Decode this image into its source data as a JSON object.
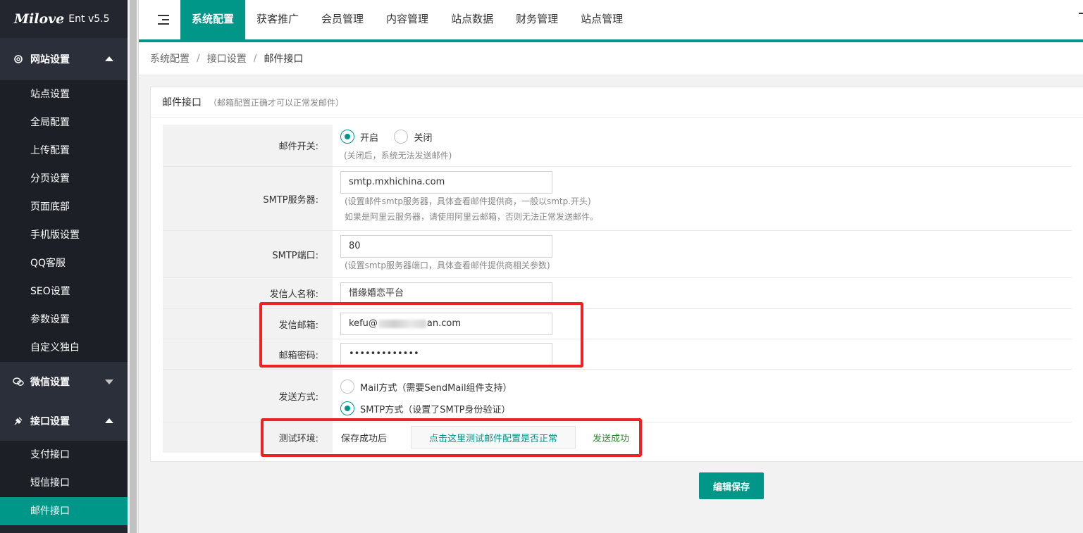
{
  "app": {
    "brand": "Milove",
    "version": "Ent v5.5"
  },
  "sidebar": {
    "groups": [
      {
        "label": "网站设置",
        "icon": "gear-icon",
        "expanded": true,
        "items": [
          "站点设置",
          "全局配置",
          "上传配置",
          "分页设置",
          "页面底部",
          "手机版设置",
          "QQ客服",
          "SEO设置",
          "参数设置",
          "自定义独白"
        ]
      },
      {
        "label": "微信设置",
        "icon": "wechat-icon",
        "expanded": false,
        "items": []
      },
      {
        "label": "接口设置",
        "icon": "plug-icon",
        "expanded": true,
        "items": [
          "支付接口",
          "短信接口",
          "邮件接口"
        ]
      }
    ],
    "active_item": "邮件接口"
  },
  "topnav": {
    "tabs": [
      "系统配置",
      "获客推广",
      "会员管理",
      "内容管理",
      "站点数据",
      "财务管理",
      "站点管理"
    ],
    "active": "系统配置"
  },
  "breadcrumb": {
    "items": [
      "系统配置",
      "接口设置",
      "邮件接口"
    ],
    "separator": "/"
  },
  "card": {
    "title": "邮件接口",
    "desc": "（邮箱配置正确才可以正常发邮件）"
  },
  "form": {
    "mail_switch": {
      "label": "邮件开关:",
      "options": [
        "开启",
        "关闭"
      ],
      "selected": "开启",
      "hint": "(关闭后，系统无法发送邮件)"
    },
    "smtp_server": {
      "label": "SMTP服务器:",
      "value": "smtp.mxhichina.com",
      "hint1": "(设置邮件smtp服务器，具体查看邮件提供商，一般以smtp.开头)",
      "hint2": "如果是阿里云服务器，请使用阿里云邮箱，否则无法正常发送邮件。"
    },
    "smtp_port": {
      "label": "SMTP端口:",
      "value": "80",
      "hint": "(设置smtp服务器端口，具体查看邮件提供商相关参数)"
    },
    "sender_name": {
      "label": "发信人名称:",
      "value": "惜缘婚恋平台"
    },
    "sender_email": {
      "label": "发信邮箱:",
      "value_prefix": "kefu@",
      "value_suffix": "an.com"
    },
    "email_password": {
      "label": "邮箱密码:",
      "value": "•••••••••••••"
    },
    "send_method": {
      "label": "发送方式:",
      "options": [
        "Mail方式（需要SendMail组件支持）",
        "SMTP方式（设置了SMTP身份验证）"
      ],
      "selected": "SMTP方式（设置了SMTP身份验证）"
    },
    "test_env": {
      "label": "测试环境:",
      "prefix": "保存成功后",
      "button": "点击这里测试邮件配置是否正常",
      "result": "发送成功"
    }
  },
  "save_button": "编辑保存",
  "colors": {
    "accent": "#009688",
    "sidebar_bg": "#23262e",
    "highlight": "#ee2222"
  }
}
